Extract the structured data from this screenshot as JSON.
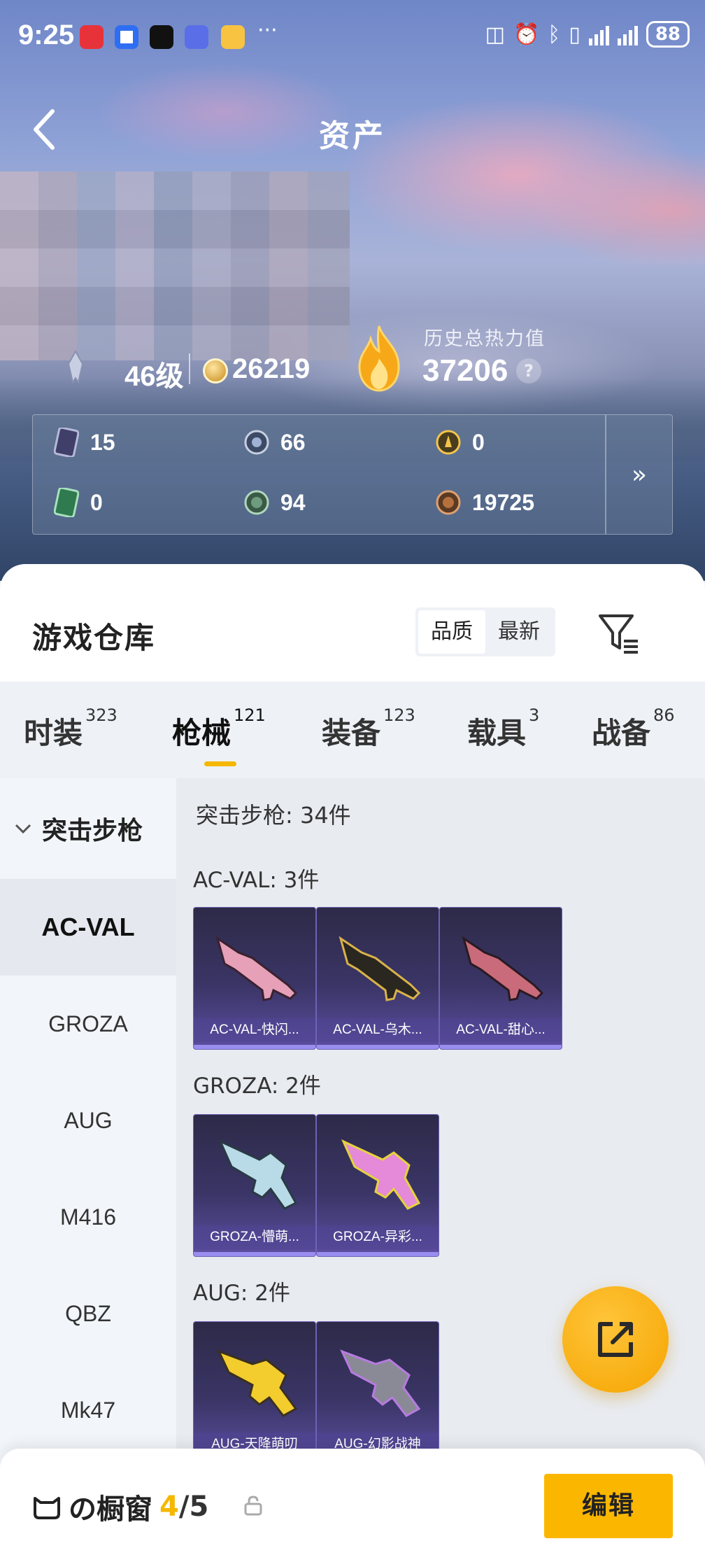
{
  "status_bar": {
    "time": "9:25",
    "more": "···",
    "battery": "88"
  },
  "header": {
    "title": "资产"
  },
  "stats": {
    "level": "46级",
    "coins": "26219",
    "hot_label": "历史总热力值",
    "hot_value": "37206",
    "help": "?"
  },
  "assets": [
    {
      "icon": "card-icon",
      "value": "15"
    },
    {
      "icon": "silver-badge-icon",
      "value": "66"
    },
    {
      "icon": "gold-badge-icon",
      "value": "0"
    },
    {
      "icon": "green-card-icon",
      "value": "0"
    },
    {
      "icon": "green-badge-icon",
      "value": "94"
    },
    {
      "icon": "bronze-badge-icon",
      "value": "19725"
    }
  ],
  "warehouse": {
    "title": "游戏仓库",
    "sort_options": [
      "品质",
      "最新"
    ],
    "sort_selected": "品质"
  },
  "tabs": [
    {
      "label": "时装",
      "count": "323"
    },
    {
      "label": "枪械",
      "count": "121"
    },
    {
      "label": "装备",
      "count": "123"
    },
    {
      "label": "载具",
      "count": "3"
    },
    {
      "label": "战备",
      "count": "86"
    }
  ],
  "active_tab": "枪械",
  "sidebar": {
    "group": "突击步枪",
    "items": [
      "AC-VAL",
      "GROZA",
      "AUG",
      "M416",
      "QBZ",
      "Mk47"
    ],
    "active": "AC-VAL"
  },
  "content": {
    "total": "突击步枪: 34件",
    "groups": [
      {
        "label": "AC-VAL: 3件",
        "cards": [
          "AC-VAL-快闪...",
          "AC-VAL-乌木...",
          "AC-VAL-甜心..."
        ]
      },
      {
        "label": "GROZA: 2件",
        "cards": [
          "GROZA-懵萌...",
          "GROZA-异彩..."
        ]
      },
      {
        "label": "AUG: 2件",
        "cards": [
          "AUG-天降萌叨",
          "AUG-幻影战神"
        ]
      }
    ]
  },
  "bottom": {
    "window_label": "の橱窗",
    "count_current": "4",
    "count_sep": "/",
    "count_total": "5",
    "edit_label": "编辑"
  },
  "colors": {
    "accent": "#f5b700",
    "card_bg": "#3a3566"
  }
}
